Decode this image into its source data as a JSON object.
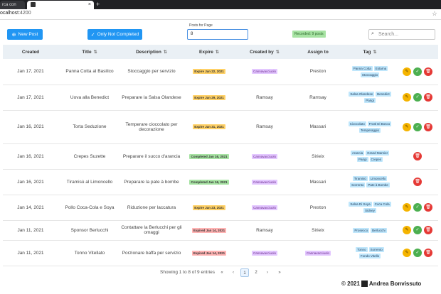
{
  "browser": {
    "tab1_title": "rca con",
    "tab2_title": "",
    "url_host": "ocalhost",
    "url_port": ":4200"
  },
  "toolbar": {
    "new_post": "New Post",
    "not_completed": "Only Not Completed",
    "posts_per_page_label": "Posts for Page",
    "posts_per_page_value": "8",
    "recorded": "Recorded: 9 posts",
    "search_placeholder": "Search..."
  },
  "table": {
    "headers": [
      "Created",
      "Title",
      "Description",
      "Expire",
      "Created by",
      "Assign to",
      "Tag"
    ],
    "rows": [
      {
        "created": "Jan 17, 2021",
        "title": "Panna Cotta al Basilico",
        "description": "Stoccaggio per servizio",
        "expire": "Expire Jan 22, 2021",
        "expire_type": "expire",
        "created_by": "Cannavacciuolo",
        "created_by_badge": true,
        "assign": "Preston",
        "assign_badge": false,
        "tags": [
          "Panna Cotta",
          "Estarna",
          "Stoccaggio"
        ],
        "actions": [
          "edit",
          "done",
          "del"
        ]
      },
      {
        "created": "Jan 17, 2021",
        "title": "Uova alla Benedict",
        "description": "Preparare la Salsa Olandese",
        "expire": "Expire Jan 29, 2021",
        "expire_type": "plain",
        "created_by": "Ramsay",
        "created_by_badge": false,
        "assign": "Ramsay",
        "assign_badge": false,
        "tags": [
          "Salsa Olandese",
          "Benedict",
          "Parigi"
        ],
        "actions": [
          "edit",
          "done",
          "del"
        ]
      },
      {
        "created": "Jan 16, 2021",
        "title": "Torta Seduzione",
        "description": "Temperare cioccolato per decorazione",
        "expire": "Expire Jan 31, 2021",
        "expire_type": "plain",
        "created_by": "Ramsay",
        "created_by_badge": false,
        "assign": "Massari",
        "assign_badge": false,
        "tags": [
          "Cioccolato",
          "Frutti Di Bosco",
          "Temperaggio"
        ],
        "actions": [
          "edit",
          "done",
          "del"
        ]
      },
      {
        "created": "Jan 16, 2021",
        "title": "Crepes Suzette",
        "description": "Preparare il succo d'arancia",
        "expire": "Completed Jan 16, 2021",
        "expire_type": "completed",
        "created_by": "Cannavacciuolo",
        "created_by_badge": true,
        "assign": "Sirieix",
        "assign_badge": false,
        "tags": [
          "Arancia",
          "Grand Marnier",
          "Parigi",
          "Crepes"
        ],
        "actions": [
          "del"
        ]
      },
      {
        "created": "Jan 16, 2021",
        "title": "Tiramisù al Limoncello",
        "description": "Preparare la pate à bombe",
        "expire": "Completed Jan 16, 2021",
        "expire_type": "completed",
        "created_by": "Cannavacciuolo",
        "created_by_badge": true,
        "assign": "Massari",
        "assign_badge": false,
        "tags": [
          "Tiramisù",
          "Limoncello",
          "Sorrento",
          "Pate à Bombe"
        ],
        "actions": [
          "del"
        ]
      },
      {
        "created": "Jan 14, 2021",
        "title": "Pollo Coca-Cola e Soya",
        "description": "Riduzione per laccatura",
        "expire": "Expire Jan 23, 2021",
        "expire_type": "expire",
        "created_by": "Cannavacciuolo",
        "created_by_badge": true,
        "assign": "Preston",
        "assign_badge": false,
        "tags": [
          "Salsa Di Soya",
          "Coca Cola",
          "Sidney"
        ],
        "actions": [
          "edit",
          "done",
          "del"
        ]
      },
      {
        "created": "Jan 11, 2021",
        "title": "Sponsor Berlucchi",
        "description": "Contattare la Berlucchi per gli omaggi",
        "expire": "Expired Jan 14, 2021",
        "expire_type": "expired",
        "created_by": "Ramsay",
        "created_by_badge": false,
        "assign": "Sirieix",
        "assign_badge": false,
        "tags": [
          "Prosecco",
          "Berlucchi"
        ],
        "actions": [
          "edit",
          "done",
          "del"
        ]
      },
      {
        "created": "Jan 11, 2021",
        "title": "Tonno Vitellato",
        "description": "Porzionare baffa per servizio",
        "expire": "Expired Jan 14, 2021",
        "expire_type": "expired",
        "created_by": "Cannavacciuolo",
        "created_by_badge": true,
        "assign": "Cannavacciuolo",
        "assign_badge": true,
        "tags": [
          "Tonno",
          "Sorrento",
          "Fondo Vitello"
        ],
        "actions": [
          "edit",
          "done",
          "del"
        ]
      }
    ]
  },
  "pagination": {
    "summary": "Showing 1 to 8 of 9 entries",
    "first": "«",
    "prev": "‹",
    "pages": [
      "1",
      "2"
    ],
    "next": "›",
    "last": "»"
  },
  "footer": {
    "copyright": "© 2021",
    "author": "Andrea Bonvissuto"
  }
}
